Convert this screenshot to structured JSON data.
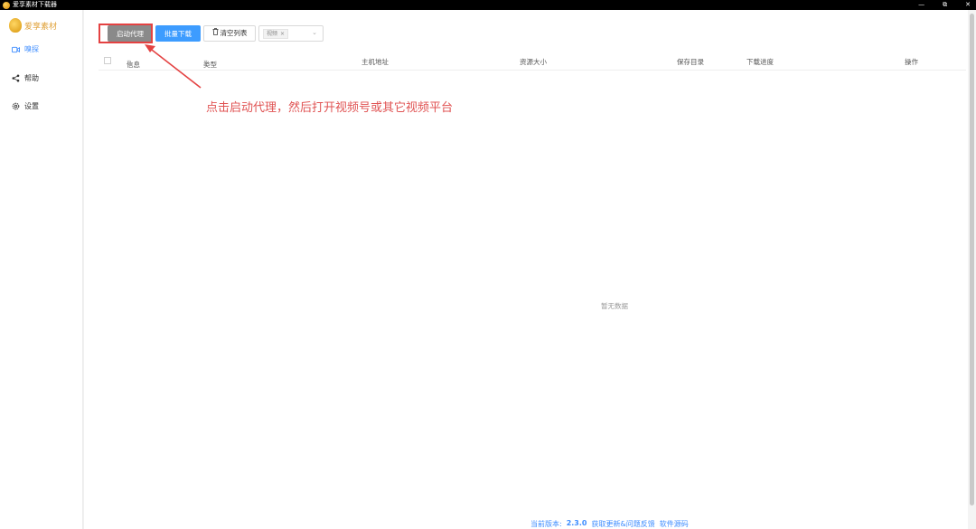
{
  "window": {
    "title": "爱享素材下载器",
    "controls": [
      "—",
      "⧉",
      "✕"
    ]
  },
  "sidebar": {
    "brand": "爱享素材",
    "items": [
      {
        "label": "嗅探",
        "icon": "video-icon",
        "active": true
      },
      {
        "label": "帮助",
        "icon": "share-icon",
        "active": false
      },
      {
        "label": "设置",
        "icon": "gear-icon",
        "active": false
      }
    ]
  },
  "toolbar": {
    "proxy_label": "启动代理",
    "batch_label": "批量下载",
    "clear_label": "清空列表",
    "filter_tag": "视频",
    "filter_tag_close": "×"
  },
  "table": {
    "columns": [
      "信息",
      "类型",
      "主机地址",
      "资源大小",
      "保存目录",
      "下载进度",
      "操作"
    ],
    "empty_text": "暂无数据"
  },
  "annotation": {
    "text": "点击启动代理，然后打开视频号或其它视频平台",
    "color": "#e05353"
  },
  "footer": {
    "version_label": "当前版本:",
    "version": "2.3.0",
    "feedback": "获取更新&问题反馈",
    "source": "软件源码"
  },
  "colors": {
    "accent": "#3c8cff",
    "annotation": "#e05353",
    "brand": "#e0a23a"
  }
}
